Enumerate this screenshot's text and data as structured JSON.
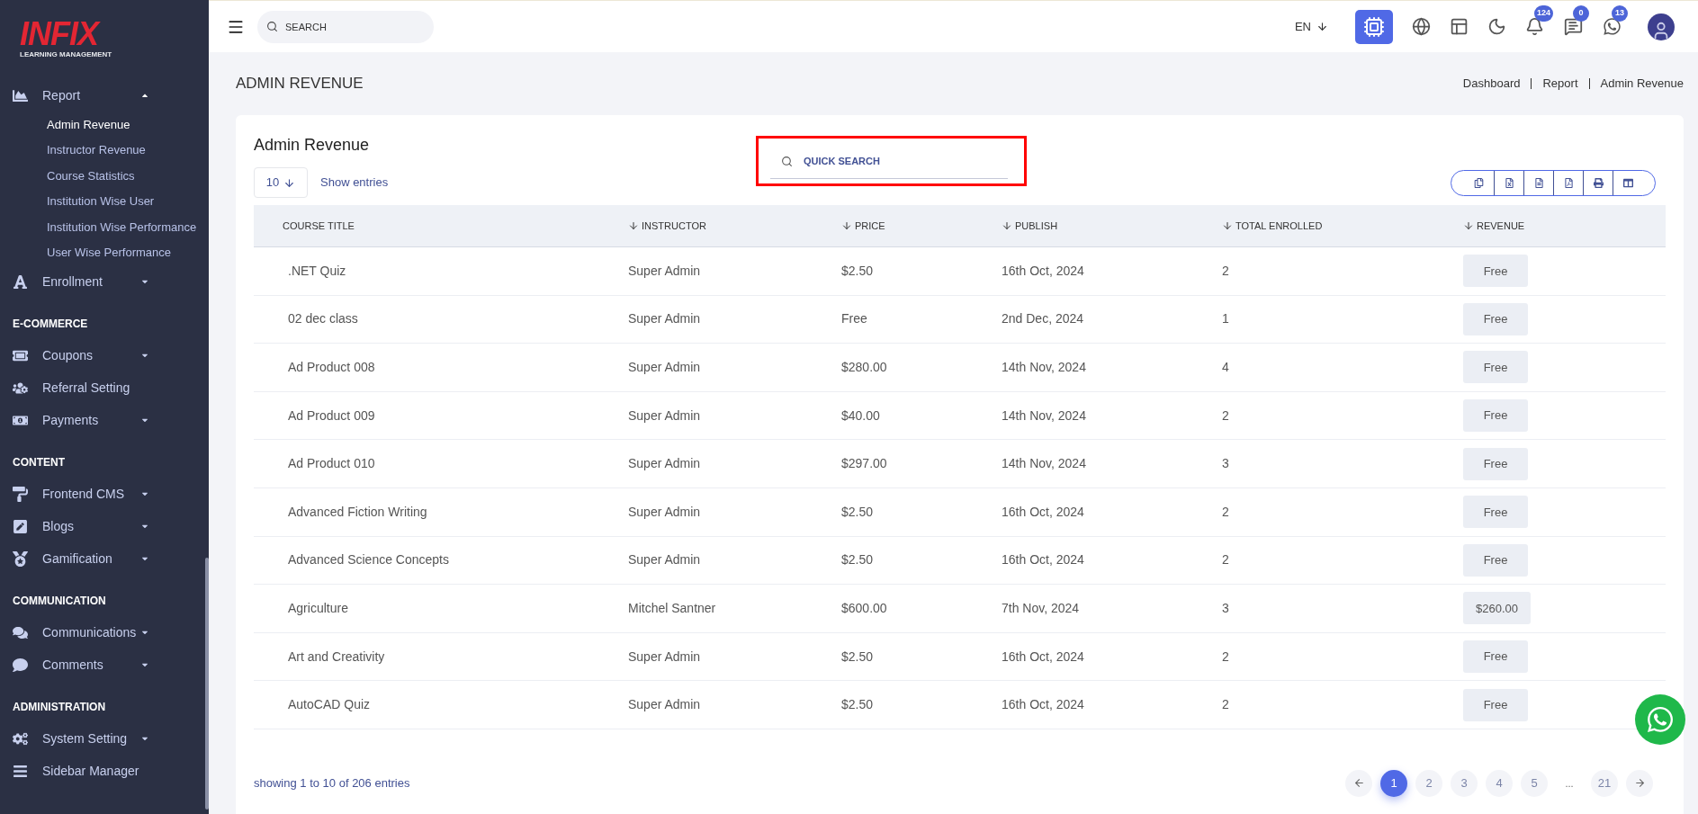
{
  "sidebar": {
    "logo": {
      "name": "INFIX",
      "tagline": "LEARNING MANAGEMENT"
    },
    "items": [
      {
        "kind": "item",
        "label": "Report",
        "expanded": true,
        "children": [
          {
            "label": "Admin Revenue",
            "selected": true
          },
          {
            "label": "Instructor Revenue",
            "selected": false
          },
          {
            "label": "Course Statistics",
            "selected": false
          },
          {
            "label": "Institution Wise User",
            "selected": false
          },
          {
            "label": "Institution Wise Performance",
            "selected": false
          },
          {
            "label": "User Wise Performance",
            "selected": false
          }
        ]
      },
      {
        "kind": "item",
        "label": "Enrollment",
        "expanded": false
      },
      {
        "kind": "heading",
        "label": "E-COMMERCE"
      },
      {
        "kind": "item",
        "label": "Coupons",
        "expanded": false
      },
      {
        "kind": "item",
        "label": "Referral Setting"
      },
      {
        "kind": "item",
        "label": "Payments",
        "expanded": false
      },
      {
        "kind": "heading",
        "label": "CONTENT"
      },
      {
        "kind": "item",
        "label": "Frontend CMS",
        "expanded": false
      },
      {
        "kind": "item",
        "label": "Blogs",
        "expanded": false
      },
      {
        "kind": "item",
        "label": "Gamification",
        "expanded": false
      },
      {
        "kind": "heading",
        "label": "COMMUNICATION"
      },
      {
        "kind": "item",
        "label": "Communications",
        "expanded": false
      },
      {
        "kind": "item",
        "label": "Comments",
        "expanded": false
      },
      {
        "kind": "heading",
        "label": "ADMINISTRATION"
      },
      {
        "kind": "item",
        "label": "System Setting",
        "expanded": false
      },
      {
        "kind": "item",
        "label": "Sidebar Manager"
      }
    ]
  },
  "topbar": {
    "search": {
      "placeholder": "SEARCH"
    },
    "language": "EN",
    "badges": [
      "124",
      "0",
      "13"
    ]
  },
  "page": {
    "title": "ADMIN REVENUE",
    "breadcrumb": [
      "Dashboard",
      "Report",
      "Admin Revenue"
    ]
  },
  "card": {
    "title": "Admin Revenue",
    "page_size": "10",
    "show_entries": "Show entries",
    "quick_search": {
      "placeholder": "QUICK SEARCH"
    },
    "table": {
      "columns": [
        {
          "label": "COURSE TITLE",
          "sortable": false
        },
        {
          "label": "INSTRUCTOR",
          "sortable": true
        },
        {
          "label": "PRICE",
          "sortable": true
        },
        {
          "label": "PUBLISH",
          "sortable": true
        },
        {
          "label": "TOTAL ENROLLED",
          "sortable": true
        },
        {
          "label": "REVENUE",
          "sortable": true
        }
      ],
      "rows": [
        [
          ".NET Quiz",
          "Super Admin",
          "$2.50",
          "16th Oct, 2024",
          "2",
          "Free"
        ],
        [
          "02 dec class",
          "Super Admin",
          "Free",
          "2nd Dec, 2024",
          "1",
          "Free"
        ],
        [
          "Ad Product 008",
          "Super Admin",
          "$280.00",
          "14th Nov, 2024",
          "4",
          "Free"
        ],
        [
          "Ad Product 009",
          "Super Admin",
          "$40.00",
          "14th Nov, 2024",
          "2",
          "Free"
        ],
        [
          "Ad Product 010",
          "Super Admin",
          "$297.00",
          "14th Nov, 2024",
          "3",
          "Free"
        ],
        [
          "Advanced Fiction Writing",
          "Super Admin",
          "$2.50",
          "16th Oct, 2024",
          "2",
          "Free"
        ],
        [
          "Advanced Science Concepts",
          "Super Admin",
          "$2.50",
          "16th Oct, 2024",
          "2",
          "Free"
        ],
        [
          "Agriculture",
          "Mitchel Santner",
          "$600.00",
          "7th Nov, 2024",
          "3",
          "$260.00"
        ],
        [
          "Art and Creativity",
          "Super Admin",
          "$2.50",
          "16th Oct, 2024",
          "2",
          "Free"
        ],
        [
          "AutoCAD Quiz",
          "Super Admin",
          "$2.50",
          "16th Oct, 2024",
          "2",
          "Free"
        ]
      ]
    },
    "footer": "showing 1 to 10 of 206 entries",
    "pagination": [
      {
        "label": "1",
        "selected": true
      },
      {
        "label": "2",
        "selected": false
      },
      {
        "label": "3",
        "selected": false
      },
      {
        "label": "4",
        "selected": false
      },
      {
        "label": "5",
        "selected": false
      },
      {
        "label": "...",
        "kind": "gap"
      },
      {
        "label": "21",
        "selected": false
      }
    ]
  }
}
